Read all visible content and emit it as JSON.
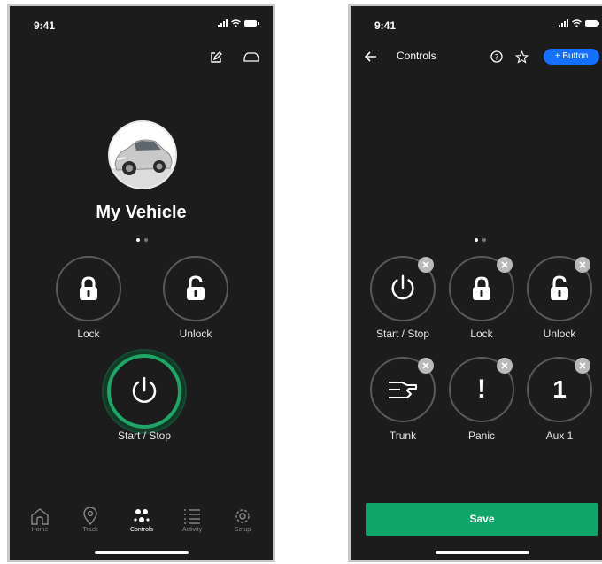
{
  "screen1": {
    "status": {
      "time": "9:41"
    },
    "header_icons": [
      "edit-icon",
      "vehicle-icon"
    ],
    "vehicle_name": "My Vehicle",
    "page_dots": {
      "count": 2,
      "active": 0
    },
    "controls": [
      {
        "label": "Lock",
        "icon": "lock-icon"
      },
      {
        "label": "Unlock",
        "icon": "unlock-icon"
      }
    ],
    "start_stop": {
      "label": "Start / Stop",
      "icon": "power-icon",
      "accent": "#1fa565"
    },
    "tabs": [
      {
        "label": "Home",
        "icon": "home-icon",
        "active": false
      },
      {
        "label": "Track",
        "icon": "location-pin-icon",
        "active": false
      },
      {
        "label": "Controls",
        "icon": "controls-icon",
        "active": true
      },
      {
        "label": "Activity",
        "icon": "list-icon",
        "active": false
      },
      {
        "label": "Setup",
        "icon": "gear-icon",
        "active": false
      }
    ]
  },
  "screen2": {
    "status": {
      "time": "9:41"
    },
    "header": {
      "title": "Controls",
      "add_button": "+ Button"
    },
    "header_icons": [
      "back-arrow-icon",
      "help-icon",
      "star-icon"
    ],
    "page_dots": {
      "count": 2,
      "active": 0
    },
    "controls": [
      {
        "label": "Start / Stop",
        "icon": "power-icon"
      },
      {
        "label": "Lock",
        "icon": "lock-icon"
      },
      {
        "label": "Unlock",
        "icon": "unlock-icon"
      },
      {
        "label": "Trunk",
        "icon": "trunk-icon"
      },
      {
        "label": "Panic",
        "icon": "exclamation-icon",
        "glyph": "!"
      },
      {
        "label": "Aux 1",
        "icon": "aux-icon",
        "glyph": "1"
      }
    ],
    "save_label": "Save"
  },
  "colors": {
    "background": "#1c1c1c",
    "accent_green": "#11a669",
    "accent_blue": "#1570ff"
  }
}
